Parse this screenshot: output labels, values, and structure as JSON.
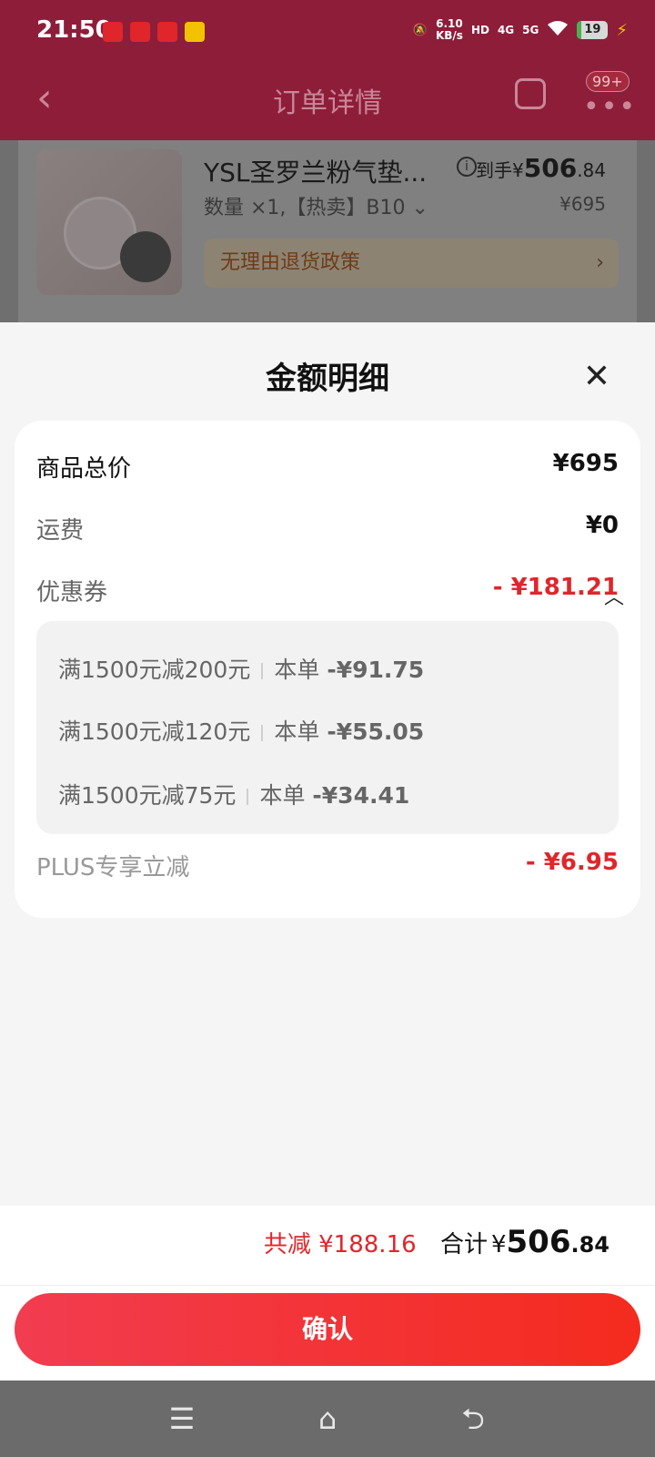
{
  "status_bar": {
    "time": "21:50",
    "net_speed": "6.10",
    "net_unit": "KB/s",
    "hd": "HD",
    "sig1": "4G",
    "sig2": "5G",
    "battery": "19"
  },
  "header": {
    "title": "订单详情",
    "badge": "99+"
  },
  "order_item": {
    "title": "YSL圣罗兰粉气垫...",
    "spec": "数量 ×1,【热卖】B10 ⌄",
    "price_prefix": "到手¥",
    "price_int": "506",
    "price_dec": ".84",
    "original_price": "¥695",
    "policy": "无理由退货政策"
  },
  "sheet": {
    "title": "金额明细",
    "rows": {
      "total": {
        "label": "商品总价",
        "value": "¥695"
      },
      "shipping": {
        "label": "运费",
        "value": "¥0"
      },
      "coupon": {
        "label": "优惠券",
        "value": "- ¥181.21"
      },
      "plus": {
        "label": "PLUS专享立减",
        "value": "- ¥6.95"
      }
    },
    "coupons": [
      {
        "rule": "满1500元减200元",
        "scope": "本单",
        "amount": "-¥91.75"
      },
      {
        "rule": "满1500元减120元",
        "scope": "本单",
        "amount": "-¥55.05"
      },
      {
        "rule": "满1500元减75元",
        "scope": "本单",
        "amount": "-¥34.41"
      }
    ]
  },
  "summary": {
    "saved_label": "共减",
    "saved_amount": "¥188.16",
    "total_label": "合计",
    "total_currency": "¥",
    "total_int": "506",
    "total_dec": ".84"
  },
  "confirm_label": "确认",
  "colors": {
    "accent": "#e0262b",
    "button_start": "#f23c50",
    "button_end": "#f42b1e"
  }
}
